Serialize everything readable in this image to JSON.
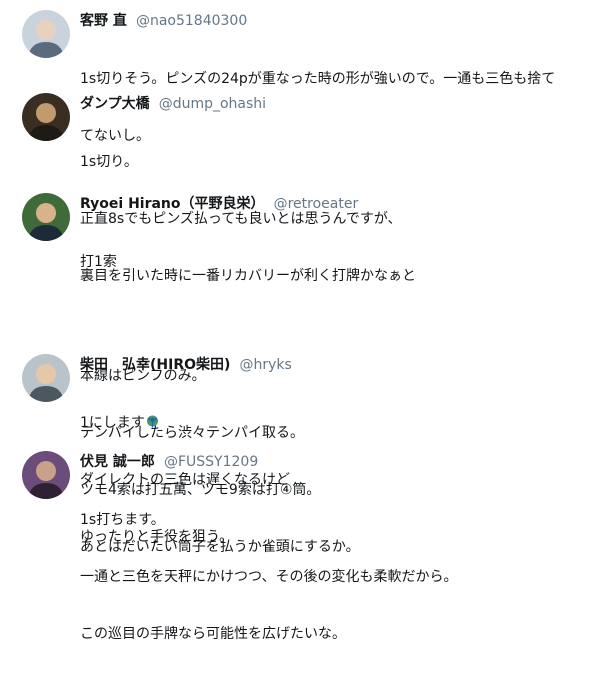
{
  "tweets": [
    {
      "name": "客野 直",
      "handle": "@nao51840300",
      "lines": [
        "1s切りそう。ピンズの24pが重なった時の形が強いので。一通も三色も捨て",
        "てないし。"
      ],
      "avatar_colors": [
        "#c9d3de",
        "#5b6b7e",
        "#e8d2bd"
      ]
    },
    {
      "name": "ダンプ大橋",
      "handle": "@dump_ohashi",
      "lines": [
        "1s切り。",
        "正直8sでもピンズ払っても良いとは思うんですが、",
        "裏目を引いた時に一番リカバリーが利く打牌かなぁと"
      ],
      "avatar_colors": [
        "#3a2e22",
        "#1e1a16",
        "#c29a6d"
      ]
    },
    {
      "name": "Ryoei Hirano（平野良栄）",
      "handle": "@retroeater",
      "lines": [
        "打1索",
        "",
        "本線はピンフのみ。",
        "テンパイしたら渋々テンパイ取る。",
        "ツモ4索は打五萬、ツモ9索は打④筒。",
        "あとはだいたい筒子を払うか雀頭にするか。"
      ],
      "avatar_colors": [
        "#3f6b3a",
        "#1d2a3a",
        "#d9b28c"
      ]
    },
    {
      "name": "柴田　弘幸(HIRO柴田)",
      "handle": "@hryks",
      "lines": [
        "1にします",
        "ダイレクトの三色は遅くなるけど",
        "ゆったりと手役を狙う。"
      ],
      "emoji": "peacock-icon",
      "avatar_colors": [
        "#b8c4c9",
        "#4c5860",
        "#e6c7a8"
      ]
    },
    {
      "name": "伏見 誠一郎",
      "handle": "@FUSSY1209",
      "lines": [
        "1s打ちます。",
        "一通と三色を天秤にかけつつ、その後の変化も柔軟だから。",
        "この巡目の手牌なら可能性を広げたいな。"
      ],
      "avatar_colors": [
        "#6b4c7a",
        "#2e2232",
        "#c9a08a"
      ]
    }
  ]
}
